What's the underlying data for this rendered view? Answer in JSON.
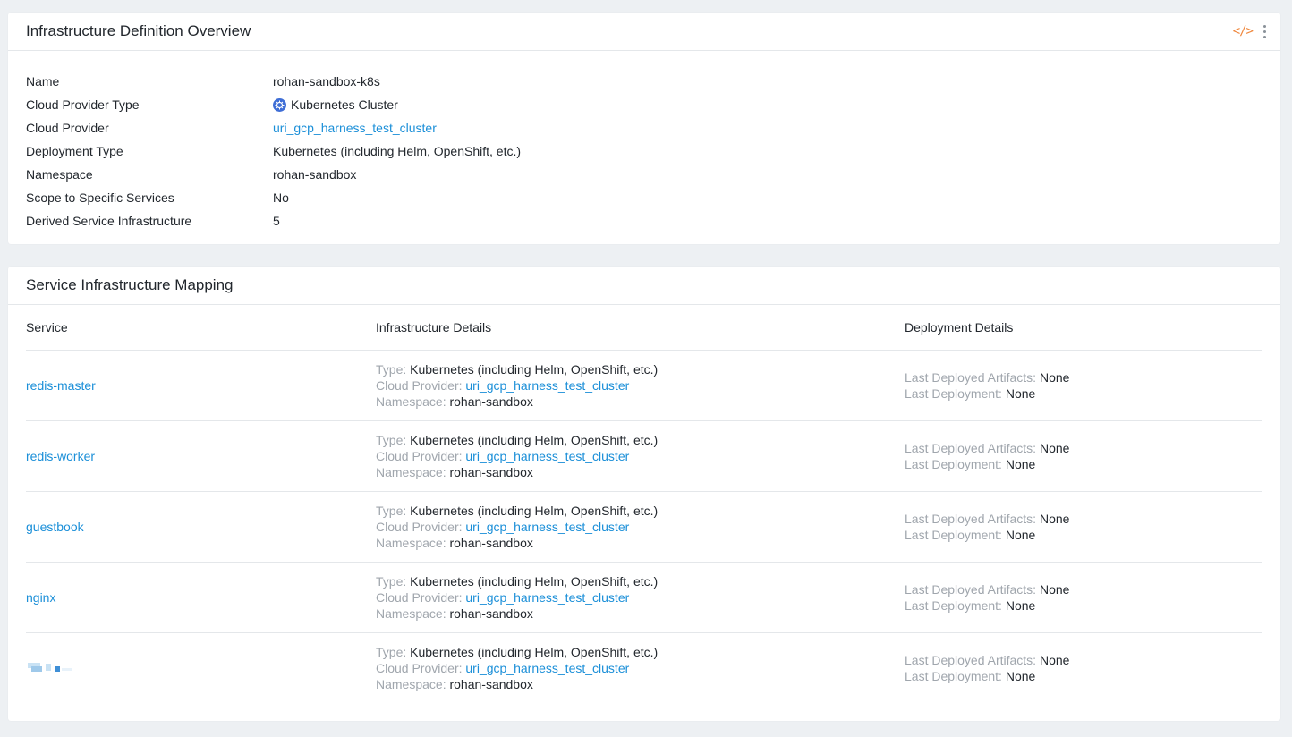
{
  "overview": {
    "title": "Infrastructure Definition Overview",
    "header_icons": {
      "code": "code-icon",
      "more": "kebab-menu-icon"
    },
    "fields": [
      {
        "label": "Name",
        "value": "rohan-sandbox-k8s"
      },
      {
        "label": "Cloud Provider Type",
        "value": "Kubernetes Cluster",
        "icon": "kubernetes-icon"
      },
      {
        "label": "Cloud Provider",
        "value": "uri_gcp_harness_test_cluster",
        "link": true
      },
      {
        "label": "Deployment Type",
        "value": "Kubernetes (including Helm, OpenShift, etc.)"
      },
      {
        "label": "Namespace",
        "value": "rohan-sandbox"
      },
      {
        "label": "Scope to Specific Services",
        "value": "No"
      },
      {
        "label": "Derived Service Infrastructure",
        "value": "5"
      }
    ]
  },
  "mapping": {
    "title": "Service Infrastructure Mapping",
    "columns": [
      "Service",
      "Infrastructure Details",
      "Deployment Details"
    ],
    "labels": {
      "type": "Type:",
      "cloud_provider": "Cloud Provider:",
      "namespace": "Namespace:",
      "last_artifacts": "Last Deployed Artifacts:",
      "last_deployment": "Last Deployment:"
    },
    "rows": [
      {
        "service": "redis-master",
        "type": "Kubernetes (including Helm, OpenShift, etc.)",
        "cloud_provider": "uri_gcp_harness_test_cluster",
        "namespace": "rohan-sandbox",
        "last_artifacts": "None",
        "last_deployment": "None"
      },
      {
        "service": "redis-worker",
        "type": "Kubernetes (including Helm, OpenShift, etc.)",
        "cloud_provider": "uri_gcp_harness_test_cluster",
        "namespace": "rohan-sandbox",
        "last_artifacts": "None",
        "last_deployment": "None"
      },
      {
        "service": "guestbook",
        "type": "Kubernetes (including Helm, OpenShift, etc.)",
        "cloud_provider": "uri_gcp_harness_test_cluster",
        "namespace": "rohan-sandbox",
        "last_artifacts": "None",
        "last_deployment": "None"
      },
      {
        "service": "nginx",
        "type": "Kubernetes (including Helm, OpenShift, etc.)",
        "cloud_provider": "uri_gcp_harness_test_cluster",
        "namespace": "rohan-sandbox",
        "last_artifacts": "None",
        "last_deployment": "None"
      },
      {
        "service": "",
        "service_redacted": true,
        "type": "Kubernetes (including Helm, OpenShift, etc.)",
        "cloud_provider": "uri_gcp_harness_test_cluster",
        "namespace": "rohan-sandbox",
        "last_artifacts": "None",
        "last_deployment": "None"
      }
    ]
  },
  "colors": {
    "link": "#1b8fd8",
    "muted": "#a0a6ad",
    "accent_icon": "#f0883e",
    "background": "#edf0f3"
  }
}
